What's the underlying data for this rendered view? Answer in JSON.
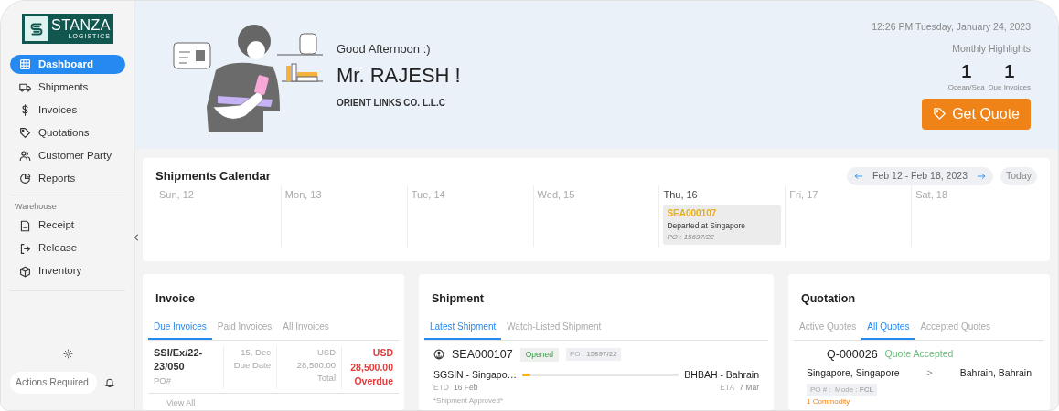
{
  "sidebar": {
    "logo": {
      "name": "STANZA",
      "tagline": "LOGISTICS"
    },
    "items": [
      {
        "label": "Dashboard",
        "selected": true
      },
      {
        "label": "Shipments",
        "selected": false
      },
      {
        "label": "Invoices",
        "selected": false
      },
      {
        "label": "Quotations",
        "selected": false
      },
      {
        "label": "Customer Party",
        "selected": false
      },
      {
        "label": "Reports",
        "selected": false
      }
    ],
    "section": "Warehouse",
    "warehouse_items": [
      {
        "label": "Receipt",
        "selected": false
      },
      {
        "label": "Release",
        "selected": false
      },
      {
        "label": "Inventory",
        "selected": false
      }
    ],
    "actions_placeholder": "Actions Required"
  },
  "header": {
    "greeting": "Good Afternoon :)",
    "name": "Mr. RAJESH !",
    "company": "ORIENT LINKS CO. L.L.C",
    "datetime": "12:26 PM Tuesday, January 24, 2023",
    "highlights_title": "Monthly Highlights",
    "stats": [
      {
        "value": "1",
        "label": "Ocean/Sea"
      },
      {
        "value": "1",
        "label": "Due Invoices"
      }
    ],
    "button": "Get Quote"
  },
  "calendar": {
    "title": "Shipments Calendar",
    "range": "Feb 12 - Feb 18, 2023",
    "today_button": "Today",
    "days": [
      {
        "label": "Sun, 12",
        "highlighted": false
      },
      {
        "label": "Mon, 13",
        "highlighted": false
      },
      {
        "label": "Tue, 14",
        "highlighted": false
      },
      {
        "label": "Wed, 15",
        "highlighted": false
      },
      {
        "label": "Thu, 16",
        "highlighted": true,
        "events": [
          {
            "code": "SEA000107",
            "status": "Departed at Singapore",
            "po": "PO : 15697/22"
          }
        ]
      },
      {
        "label": "Fri, 17",
        "highlighted": false
      },
      {
        "label": "Sat, 18",
        "highlighted": false
      }
    ]
  },
  "invoice": {
    "title": "Invoice",
    "tabs": [
      {
        "label": "Due Invoices",
        "selected": true
      },
      {
        "label": "Paid Invoices",
        "selected": false
      },
      {
        "label": "All Invoices",
        "selected": false
      }
    ],
    "rows": [
      {
        "ref": "SSI/Ex/22-23/050",
        "ref_label": "PO#",
        "date": "15, Dec",
        "date_label": "Due Date",
        "amount": "USD 28,500.00",
        "amount_label": "Total",
        "due": "USD 28,500.00",
        "due_label": "Overdue"
      }
    ],
    "view_all": "View All"
  },
  "shipment": {
    "title": "Shipment",
    "tabs": [
      {
        "label": "Latest Shipment",
        "selected": true
      },
      {
        "label": "Watch-Listed Shipment",
        "selected": false
      }
    ],
    "item": {
      "id": "SEA000107",
      "status": "Opened",
      "po": "PO : **15697/22**",
      "origin": "SGSIN - Singapo…",
      "destination": "BHBAH - Bahrain",
      "level": 0.05,
      "etd_label": "ETD",
      "etd": "16 Feb",
      "eta_label": "ETA",
      "eta": "7 Mar",
      "note": "*Shipment Approved*"
    }
  },
  "quotation": {
    "title": "Quotation",
    "tabs": [
      {
        "label": "Active Quotes",
        "selected": false
      },
      {
        "label": "All Quotes",
        "selected": true
      },
      {
        "label": "Accepted Quotes",
        "selected": false
      }
    ],
    "item": {
      "id": "Q-000026",
      "status": "Quote Accepted",
      "origin": "Singapore, Singapore",
      "separator": ">",
      "destination": "Bahrain, Bahrain",
      "meta": "PO # :  Mode : **FCL**",
      "commodity": "1 Commodity"
    }
  }
}
